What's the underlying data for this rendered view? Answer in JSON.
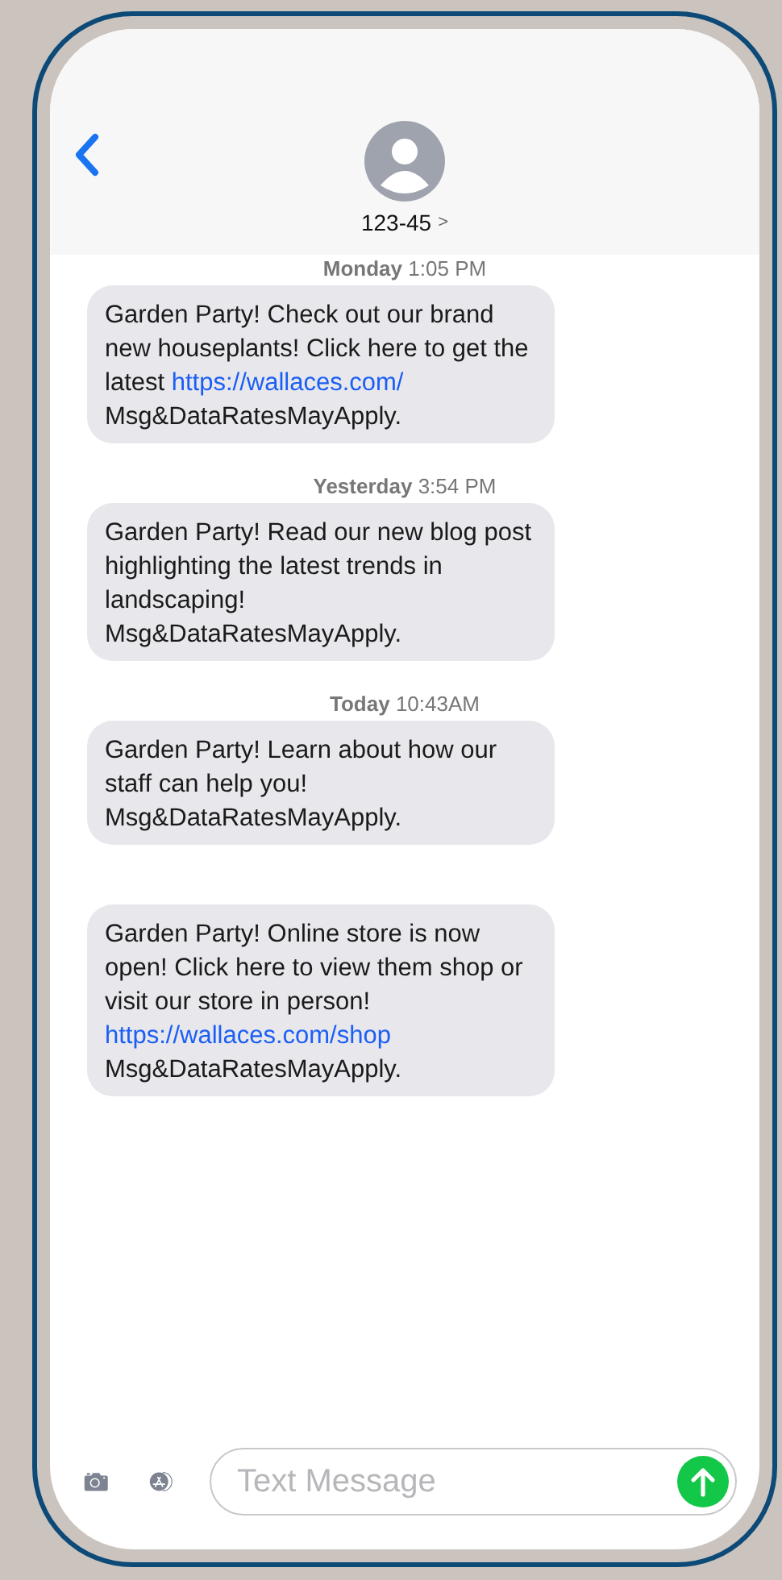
{
  "contact": {
    "name": "123-45",
    "chevron": ">"
  },
  "messages": [
    {
      "timestamp": {
        "day": "Monday",
        "time": "1:05 PM"
      },
      "parts": [
        {
          "kind": "text",
          "text": "Garden Party! Check out our brand new houseplants! Click here to get the latest "
        },
        {
          "kind": "link",
          "text": "https://wallaces.com/"
        },
        {
          "kind": "text",
          "text": " Msg&DataRatesMayApply."
        }
      ]
    },
    {
      "timestamp": {
        "day": "Yesterday",
        "time": "3:54 PM"
      },
      "parts": [
        {
          "kind": "text",
          "text": "Garden Party! Read our new blog post highlighting the latest trends in landscaping! Msg&DataRatesMayApply."
        }
      ]
    },
    {
      "timestamp": {
        "day": "Today",
        "time": "10:43AM"
      },
      "parts": [
        {
          "kind": "text",
          "text": "Garden Party! Learn about how our staff can help you! Msg&DataRatesMayApply."
        }
      ]
    },
    {
      "parts": [
        {
          "kind": "text",
          "text": "Garden Party! Online store is now open! Click here to view them shop or visit our store in person! "
        },
        {
          "kind": "link",
          "text": "https://wallaces.com/shop"
        },
        {
          "kind": "text",
          "text": " Msg&DataRatesMayApply."
        }
      ]
    }
  ],
  "composer": {
    "placeholder": "Text Message"
  }
}
